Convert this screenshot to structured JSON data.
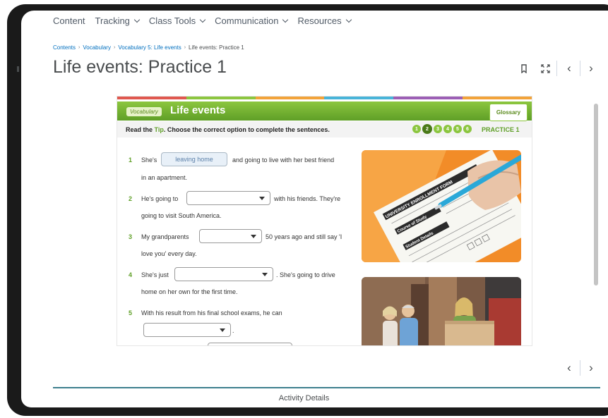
{
  "nav": {
    "items": [
      {
        "label": "Content",
        "has_menu": false
      },
      {
        "label": "Tracking",
        "has_menu": true
      },
      {
        "label": "Class Tools",
        "has_menu": true
      },
      {
        "label": "Communication",
        "has_menu": true
      },
      {
        "label": "Resources",
        "has_menu": true
      }
    ]
  },
  "breadcrumb": {
    "items": [
      "Contents",
      "Vocabulary",
      "Vocabulary 5: Life events"
    ],
    "current": "Life events: Practice 1",
    "separator": "›"
  },
  "page": {
    "title": "Life events: Practice 1"
  },
  "toolbar": {
    "bookmark_icon": "bookmark-icon",
    "fullscreen_icon": "fullscreen-icon",
    "prev_label": "‹",
    "next_label": "›"
  },
  "activity": {
    "tag": "Vocabulary",
    "title": "Life events",
    "glossary_label": "Glossary",
    "instruction_pre": "Read the ",
    "instruction_tip": "Tip",
    "instruction_post": ". Choose the correct option to complete the sentences.",
    "steps": [
      "1",
      "2",
      "3",
      "4",
      "5",
      "6"
    ],
    "active_step": "2",
    "practice_label": "PRACTICE 1",
    "questions": [
      {
        "num": "1",
        "before": "She's",
        "answer": "leaving home",
        "after": "and going to live with her best friend",
        "line2": "in an apartment."
      },
      {
        "num": "2",
        "before": "He's going to",
        "answer": "",
        "after": "with his friends. They're",
        "line2": "going to visit South America."
      },
      {
        "num": "3",
        "before": "My grandparents",
        "answer": "",
        "after": "50 years ago and still say 'I",
        "line2": "love you' every day."
      },
      {
        "num": "4",
        "before": "She's just",
        "answer": "",
        "after": ". She's going to drive",
        "line2": "home on her own for the first time."
      },
      {
        "num": "5",
        "before": "With his result from his final school exams, he can",
        "answer": "",
        "after": ".",
        "line2": ""
      }
    ],
    "image1_form_text": [
      "UNIVERSITY ENROLLMENT FORM",
      "Course of Study",
      "Student Details"
    ],
    "stripe_colors": [
      "#e0584f",
      "#8cc63f",
      "#f2a33a",
      "#48b4d9",
      "#9c5fb5",
      "#f2a33a"
    ]
  },
  "colors": {
    "accent": "#8cc63f",
    "footer_line": "#3d7f8d",
    "link": "#006fbf"
  },
  "footer": {
    "prev_label": "‹",
    "next_label": "›",
    "activity_details": "Activity Details"
  }
}
